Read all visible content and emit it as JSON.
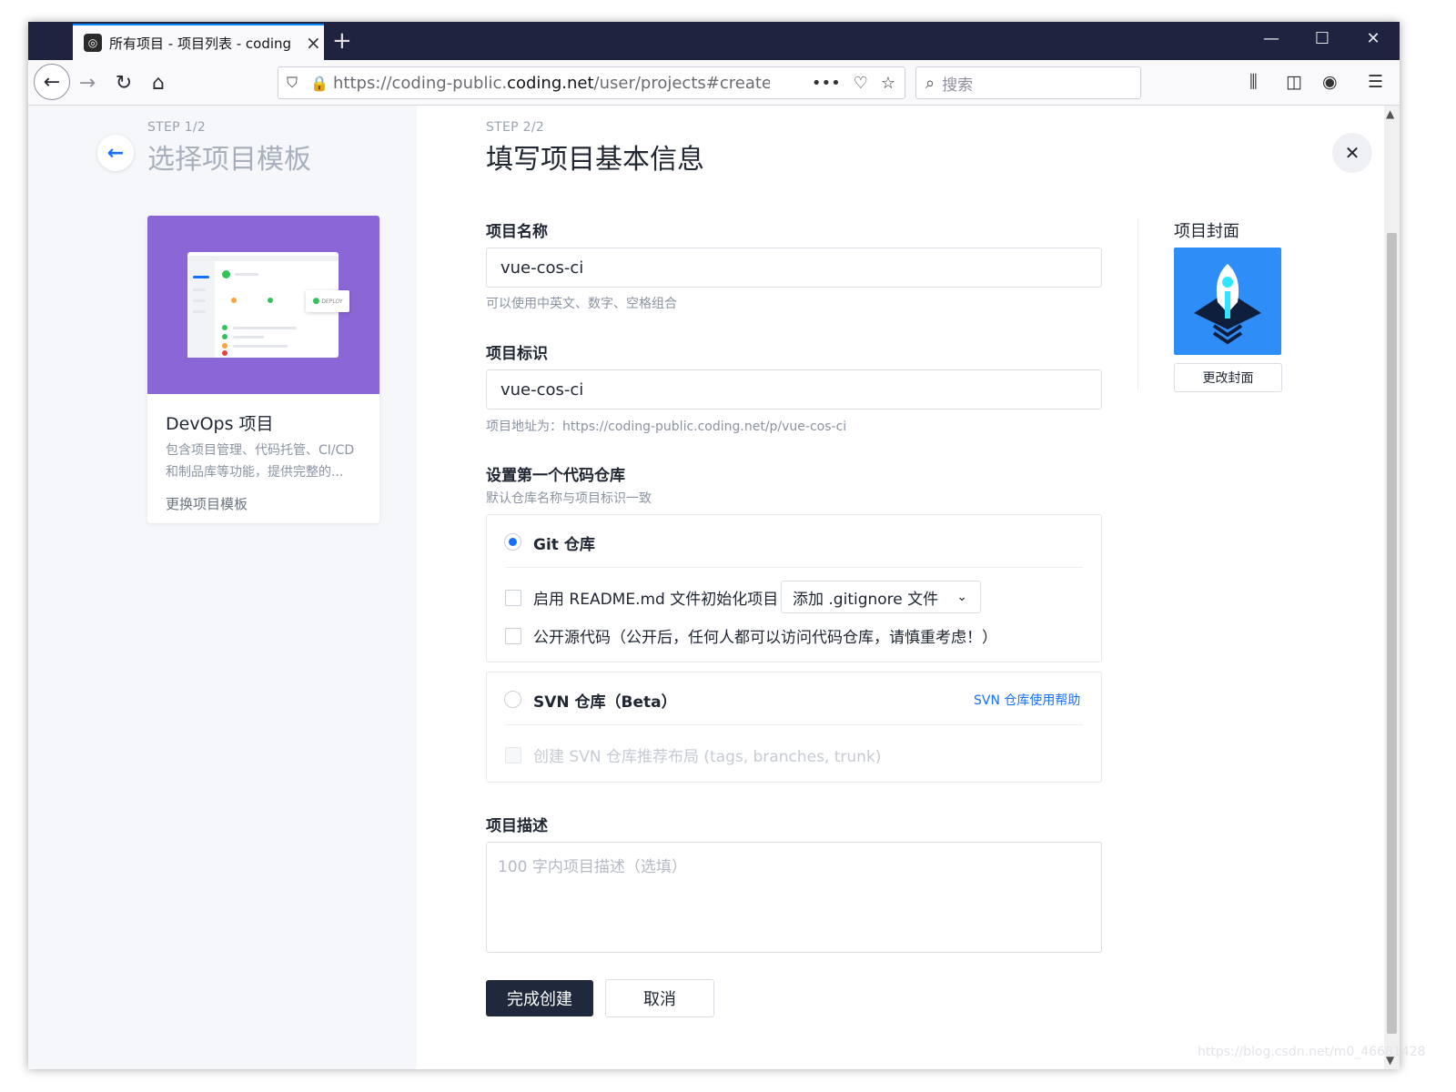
{
  "browser": {
    "tab_title": "所有项目 - 项目列表 - coding",
    "url_prefix": "https://coding-public.",
    "url_domain": "coding.net",
    "url_path": "/user/projects#create-pro",
    "search_placeholder": "搜索"
  },
  "left": {
    "step": "STEP 1/2",
    "title": "选择项目模板",
    "template_name": "DevOps 项目",
    "template_desc": "包含项目管理、代码托管、CI/CD 和制品库等功能，提供完整的...",
    "change_template": "更换项目模板",
    "deploy_badge": "DEPLOY"
  },
  "form": {
    "step": "STEP 2/2",
    "title": "填写项目基本信息",
    "name_label": "项目名称",
    "name_value": "vue-cos-ci",
    "name_hint": "可以使用中英文、数字、空格组合",
    "id_label": "项目标识",
    "id_value": "vue-cos-ci",
    "id_hint": "项目地址为：https://coding-public.coding.net/p/vue-cos-ci",
    "repo_label": "设置第一个代码仓库",
    "repo_hint": "默认仓库名称与项目标识一致",
    "git_label": "Git 仓库",
    "readme_label": "启用 README.md 文件初始化项目",
    "gitignore_select": "添加 .gitignore 文件",
    "public_label": "公开源代码（公开后，任何人都可以访问代码仓库，请慎重考虑！）",
    "svn_label": "SVN 仓库（Beta）",
    "svn_help": "SVN 仓库使用帮助",
    "svn_layout_label": "创建 SVN 仓库推荐布局 (tags, branches, trunk)",
    "desc_label": "项目描述",
    "desc_placeholder": "100 字内项目描述（选填）",
    "submit": "完成创建",
    "cancel": "取消"
  },
  "cover": {
    "label": "项目封面",
    "change": "更改封面"
  },
  "watermark": "https://blog.csdn.net/m0_46681428",
  "colors": {
    "accent": "#1670ff",
    "primary_button": "#20293b",
    "template_bg": "#8b66d6",
    "cover_bg": "#2f8df7"
  }
}
